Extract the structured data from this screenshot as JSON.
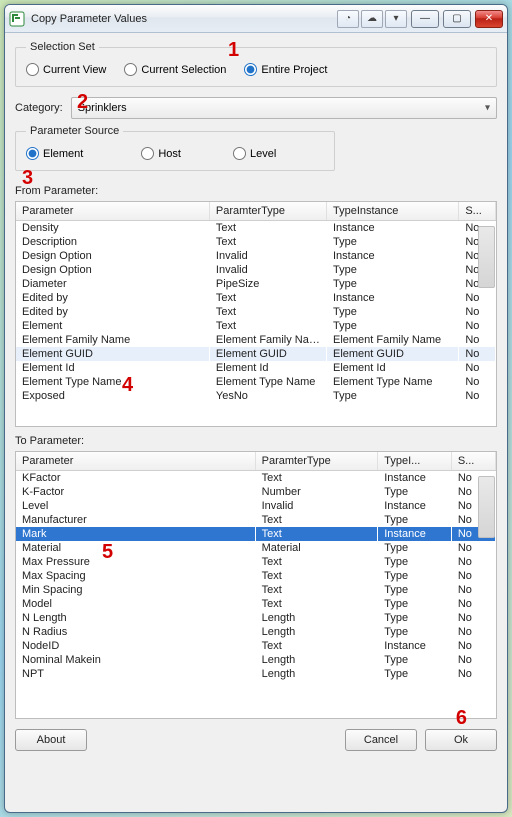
{
  "window": {
    "title": "Copy Parameter Values"
  },
  "selection_set": {
    "legend": "Selection Set",
    "options": {
      "current_view": "Current View",
      "current_selection": "Current Selection",
      "entire_project": "Entire Project"
    },
    "selected": "entire_project"
  },
  "category": {
    "label": "Category:",
    "value": "Sprinklers"
  },
  "parameter_source": {
    "legend": "Parameter Source",
    "options": {
      "element": "Element",
      "host": "Host",
      "level": "Level"
    },
    "selected": "element"
  },
  "from": {
    "label": "From Parameter:",
    "columns": {
      "c1": "Parameter",
      "c2": "ParamterType",
      "c3": "TypeInstance",
      "c4": "S..."
    },
    "rows": [
      {
        "p": "Density",
        "t": "Text",
        "ti": "Instance",
        "s": "No"
      },
      {
        "p": "Description",
        "t": "Text",
        "ti": "Type",
        "s": "No"
      },
      {
        "p": "Design Option",
        "t": "Invalid",
        "ti": "Instance",
        "s": "No"
      },
      {
        "p": "Design Option",
        "t": "Invalid",
        "ti": "Type",
        "s": "No"
      },
      {
        "p": "Diameter",
        "t": "PipeSize",
        "ti": "Type",
        "s": "No"
      },
      {
        "p": "Edited by",
        "t": "Text",
        "ti": "Instance",
        "s": "No"
      },
      {
        "p": "Edited by",
        "t": "Text",
        "ti": "Type",
        "s": "No"
      },
      {
        "p": "Element",
        "t": "Text",
        "ti": "Type",
        "s": "No"
      },
      {
        "p": "Element Family Name",
        "t": "Element Family Name",
        "ti": "Element Family Name",
        "s": "No"
      },
      {
        "p": "Element GUID",
        "t": "Element GUID",
        "ti": "Element GUID",
        "s": "No",
        "hl": true
      },
      {
        "p": "Element Id",
        "t": "Element Id",
        "ti": "Element Id",
        "s": "No"
      },
      {
        "p": "Element Type Name",
        "t": "Element Type Name",
        "ti": "Element Type Name",
        "s": "No"
      },
      {
        "p": "Exposed",
        "t": "YesNo",
        "ti": "Type",
        "s": "No"
      }
    ]
  },
  "to": {
    "label": "To Parameter:",
    "columns": {
      "c1": "Parameter",
      "c2": "ParamterType",
      "c3": "TypeI...",
      "c4": "S..."
    },
    "rows": [
      {
        "p": "KFactor",
        "t": "Text",
        "ti": "Instance",
        "s": "No"
      },
      {
        "p": "K-Factor",
        "t": "Number",
        "ti": "Type",
        "s": "No"
      },
      {
        "p": "Level",
        "t": "Invalid",
        "ti": "Instance",
        "s": "No"
      },
      {
        "p": "Manufacturer",
        "t": "Text",
        "ti": "Type",
        "s": "No"
      },
      {
        "p": "Mark",
        "t": "Text",
        "ti": "Instance",
        "s": "No",
        "sel": true
      },
      {
        "p": "Material",
        "t": "Material",
        "ti": "Type",
        "s": "No"
      },
      {
        "p": "Max Pressure",
        "t": "Text",
        "ti": "Type",
        "s": "No"
      },
      {
        "p": "Max Spacing",
        "t": "Text",
        "ti": "Type",
        "s": "No"
      },
      {
        "p": "Min Spacing",
        "t": "Text",
        "ti": "Type",
        "s": "No"
      },
      {
        "p": "Model",
        "t": "Text",
        "ti": "Type",
        "s": "No"
      },
      {
        "p": "N Length",
        "t": "Length",
        "ti": "Type",
        "s": "No"
      },
      {
        "p": "N Radius",
        "t": "Length",
        "ti": "Type",
        "s": "No"
      },
      {
        "p": "NodeID",
        "t": "Text",
        "ti": "Instance",
        "s": "No"
      },
      {
        "p": "Nominal Makein",
        "t": "Length",
        "ti": "Type",
        "s": "No"
      },
      {
        "p": "NPT",
        "t": "Length",
        "ti": "Type",
        "s": "No"
      }
    ]
  },
  "buttons": {
    "about": "About",
    "cancel": "Cancel",
    "ok": "Ok"
  },
  "annotations": {
    "n1": "1",
    "n2": "2",
    "n3": "3",
    "n4": "4",
    "n5": "5",
    "n6": "6"
  }
}
